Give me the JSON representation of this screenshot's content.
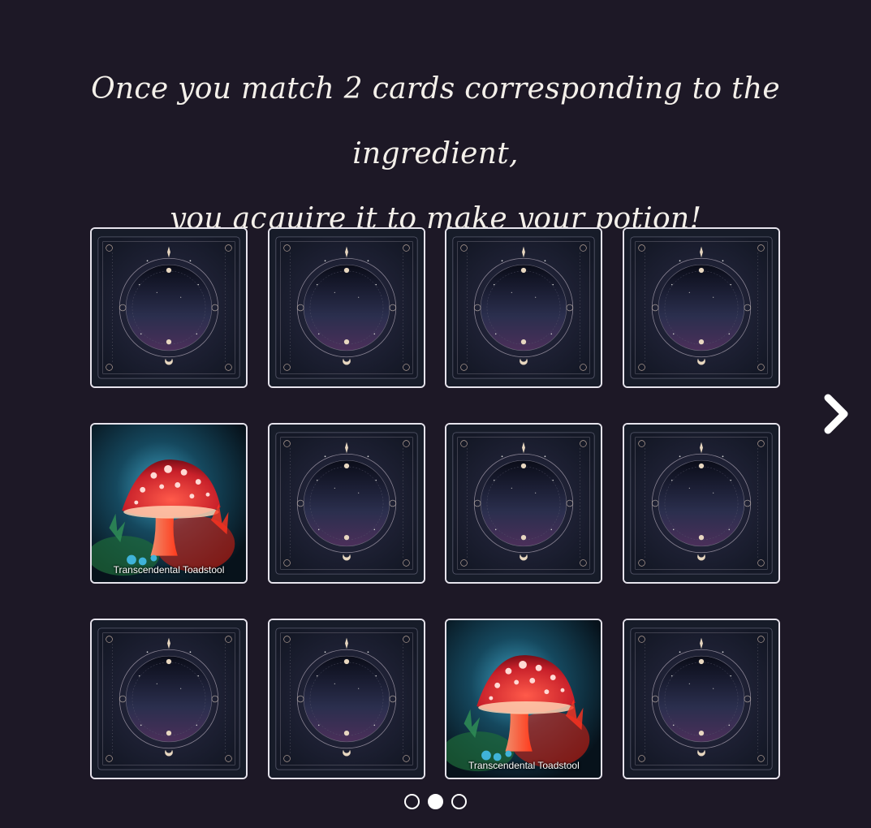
{
  "heading": {
    "line1": "Once you match 2 cards corresponding to the ingredient,",
    "line2": "you acquire it to make your potion!"
  },
  "colors": {
    "background": "#1d1826",
    "text": "#f4f0ea",
    "card_border": "#e6e3ec",
    "card_back_dark": "#0f1320",
    "mushroom_cap": "#c8202a"
  },
  "cards": [
    {
      "state": "face-down",
      "label": ""
    },
    {
      "state": "face-down",
      "label": ""
    },
    {
      "state": "face-down",
      "label": ""
    },
    {
      "state": "face-down",
      "label": ""
    },
    {
      "state": "face-up",
      "label": "Transcendental Toadstool",
      "image": "red-toadstool-mushroom"
    },
    {
      "state": "face-down",
      "label": ""
    },
    {
      "state": "face-down",
      "label": ""
    },
    {
      "state": "face-down",
      "label": ""
    },
    {
      "state": "face-down",
      "label": ""
    },
    {
      "state": "face-down",
      "label": ""
    },
    {
      "state": "face-up",
      "label": "Transcendental Toadstool",
      "image": "red-toadstool-mushroom"
    },
    {
      "state": "face-down",
      "label": ""
    }
  ],
  "navigation": {
    "next_icon": "chevron-right-icon"
  },
  "pagination": {
    "total": 3,
    "active": 2
  }
}
